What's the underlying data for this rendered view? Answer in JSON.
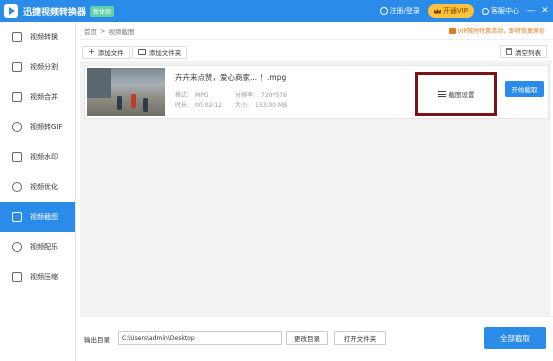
{
  "app": {
    "title": "迅捷视频转换器",
    "badge": "新体验"
  },
  "titlebar": {
    "login_label": "注册/登录",
    "vip_label": "开通VIP",
    "service_label": "客服中心",
    "minimize": "—",
    "close": "✕"
  },
  "sidebar": {
    "items": [
      {
        "label": "视频转换",
        "icon": "convert-icon",
        "active": false
      },
      {
        "label": "视频分割",
        "icon": "split-icon",
        "active": false
      },
      {
        "label": "视频合并",
        "icon": "merge-icon",
        "active": false
      },
      {
        "label": "视频转GIF",
        "icon": "gif-icon",
        "active": false
      },
      {
        "label": "视频水印",
        "icon": "watermark-icon",
        "active": false
      },
      {
        "label": "视频优化",
        "icon": "optimize-icon",
        "active": false
      },
      {
        "label": "视频截图",
        "icon": "screenshot-icon",
        "active": true
      },
      {
        "label": "视频配乐",
        "icon": "music-icon",
        "active": false
      },
      {
        "label": "视频压缩",
        "icon": "compress-icon",
        "active": false
      }
    ]
  },
  "breadcrumb": {
    "home": "首页",
    "separator": ">",
    "current": "视频截图"
  },
  "promo": {
    "text": "VIP限时特惠活动，即将恢复原价"
  },
  "toolbar": {
    "add_file": "添加文件",
    "add_folder": "添加文件夹",
    "clear_list": "清空列表"
  },
  "file": {
    "name": "卉卉来点赞，爱心商家... ！.mpg",
    "format_label": "格式:",
    "format_value": "MPG",
    "resolution_label": "分辨率:",
    "resolution_value": "720*576",
    "duration_label": "时长:",
    "duration_value": "00:02:12",
    "size_label": "大小:",
    "size_value": "133.00 MB",
    "crop_setting": "截图设置",
    "start_button": "开始截取"
  },
  "footer": {
    "output_label": "输出目录",
    "output_path": "C:\\Users\\admin\\Desktop",
    "change_dir": "更改目录",
    "open_folder": "打开文件夹",
    "capture_all": "全部截取"
  },
  "colors": {
    "accent": "#2b8be8",
    "vip": "#ffc23d",
    "highlight_border": "#7a1416",
    "promo": "#e07a1a"
  }
}
